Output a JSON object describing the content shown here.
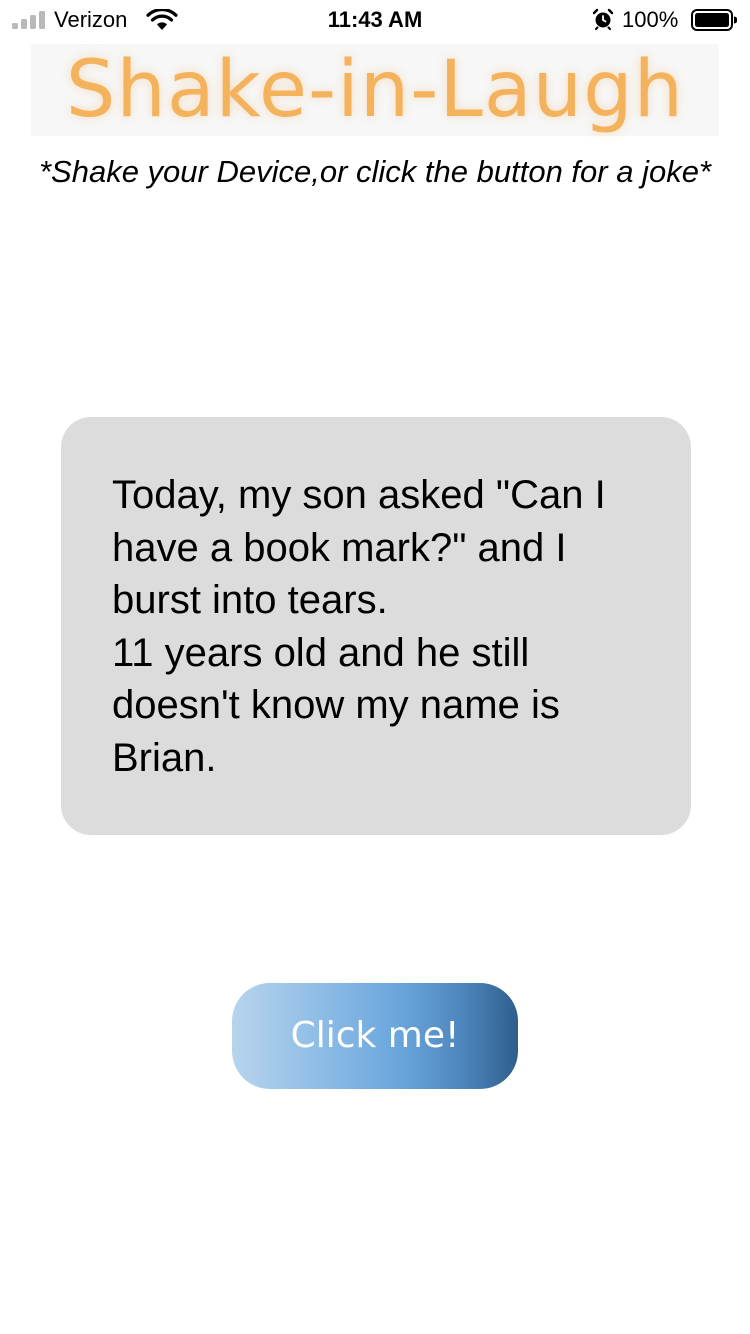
{
  "status_bar": {
    "carrier": "Verizon",
    "time": "11:43 AM",
    "battery_percent": "100%",
    "signal_icon": "signal-bars-icon",
    "wifi_icon": "wifi-icon",
    "alarm_icon": "alarm-clock-icon",
    "battery_icon": "battery-icon",
    "battery_level": 1.0
  },
  "header": {
    "title": "Shake-in-Laugh",
    "subtitle": "*Shake your Device,or click the button for a joke*",
    "title_color": "#f4b25c"
  },
  "joke": {
    "lines": [
      "Today, my son asked \"Can I",
      "have a book mark?\" and I",
      "burst into tears.",
      "11 years old and he still",
      "doesn't know my name is",
      "Brian."
    ],
    "card_color": "#dcdcdc"
  },
  "button": {
    "label": "Click me!",
    "gradient_start": "#b8d4ec",
    "gradient_end": "#2f5e8d"
  }
}
